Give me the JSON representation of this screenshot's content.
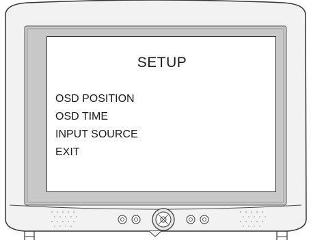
{
  "menu": {
    "title": "SETUP",
    "items": [
      {
        "label": "OSD POSITION"
      },
      {
        "label": "OSD TIME"
      },
      {
        "label": "INPUT SOURCE"
      },
      {
        "label": "EXIT"
      }
    ]
  },
  "controls": {
    "buttons": [
      {
        "icon": "circle-button-icon"
      },
      {
        "icon": "circle-button-icon"
      },
      {
        "icon": "joystick-icon"
      },
      {
        "icon": "circle-button-icon"
      },
      {
        "icon": "circle-button-icon"
      }
    ]
  },
  "colors": {
    "bezel_outer": "#f2f2f2",
    "bezel_inner": "#c8c8c8",
    "screen": "#ffffff",
    "outline": "#333333"
  }
}
